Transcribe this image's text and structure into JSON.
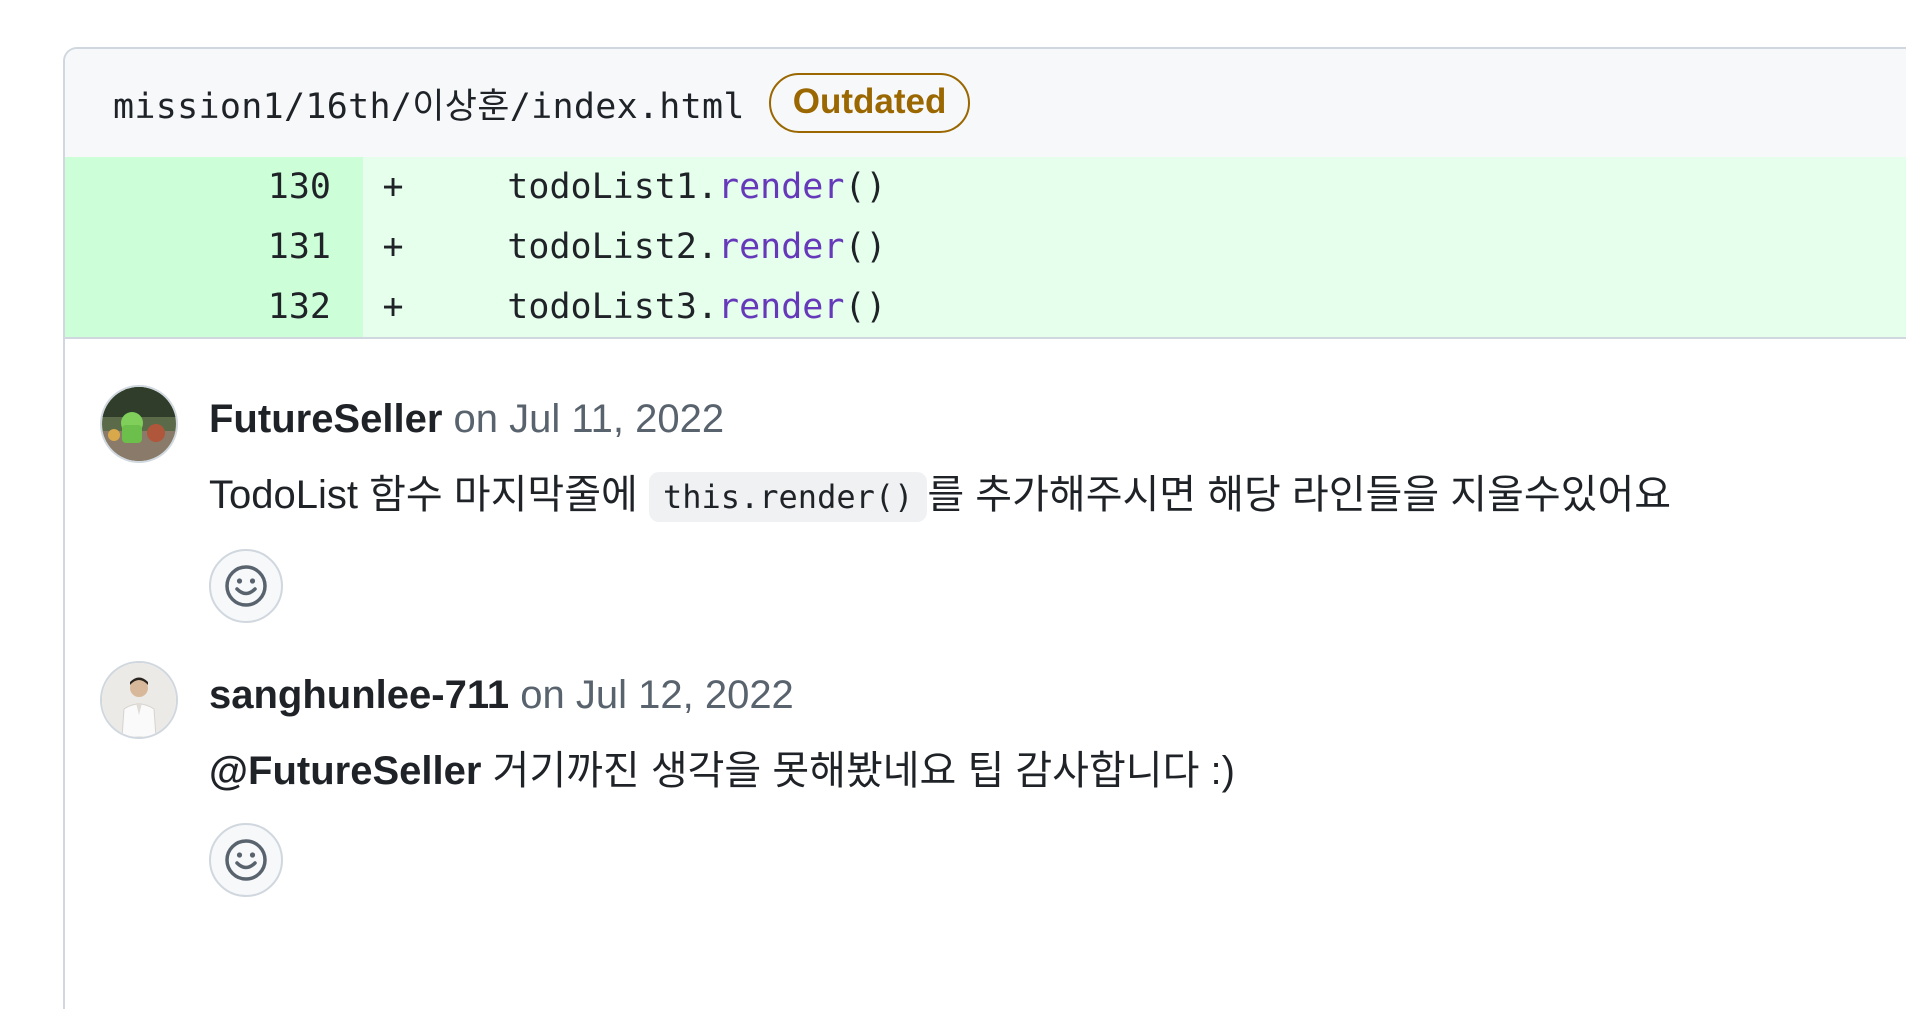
{
  "file": {
    "path": "mission1/16th/이상훈/index.html",
    "badge": "Outdated"
  },
  "diff_lines": [
    {
      "number": "130",
      "marker": "+",
      "indent": "    ",
      "object": "todoList1.",
      "method": "render",
      "args": "()"
    },
    {
      "number": "131",
      "marker": "+",
      "indent": "    ",
      "object": "todoList2.",
      "method": "render",
      "args": "()"
    },
    {
      "number": "132",
      "marker": "+",
      "indent": "    ",
      "object": "todoList3.",
      "method": "render",
      "args": "()"
    }
  ],
  "comments": [
    {
      "author": "FutureSeller",
      "timestamp": "on Jul 11, 2022",
      "body_before": "TodoList 함수 마지막줄에 ",
      "body_code": "this.render()",
      "body_after": "를 추가해주시면 해당 라인들을 지울수있어요",
      "reaction_icon": "smiley-icon"
    },
    {
      "author": "sanghunlee-711",
      "timestamp": "on Jul 12, 2022",
      "body_mention": "@FutureSeller",
      "body_text": " 거기까진 생각을 못해봤네요 팁 감사합니다 :)",
      "reaction_icon": "smiley-icon"
    }
  ],
  "colors": {
    "addition_bg": "#e6ffec",
    "addition_num_bg": "#ccffd8",
    "method": "#6639ba",
    "outdated": "#9a6700",
    "muted_text": "#59636e",
    "border": "#d0d7de"
  }
}
